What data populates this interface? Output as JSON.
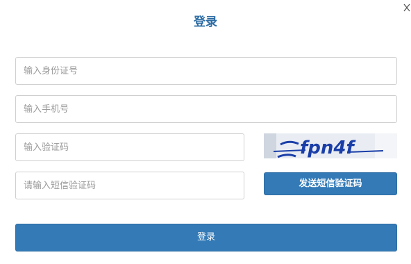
{
  "dialog": {
    "title": "登录",
    "close_icon": "close-icon"
  },
  "form": {
    "id_number_placeholder": "输入身份证号",
    "phone_placeholder": "输入手机号",
    "captcha_placeholder": "输入验证码",
    "sms_code_placeholder": "请输入短信验证码",
    "captcha_text": "fpn4f",
    "send_sms_label": "发送短信验证码",
    "login_label": "登录"
  },
  "colors": {
    "primary": "#337ab7",
    "title": "#2e6da4",
    "captcha_ink": "#1a3ea8"
  }
}
